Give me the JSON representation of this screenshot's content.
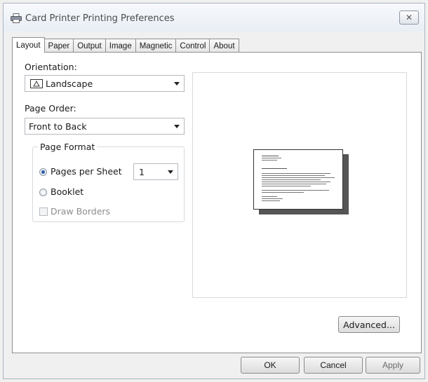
{
  "window": {
    "title": "Card Printer Printing Preferences",
    "close_glyph": "✕",
    "title_icon": "printer-icon"
  },
  "tabs": [
    {
      "label": "Layout",
      "active": true
    },
    {
      "label": "Paper"
    },
    {
      "label": "Output"
    },
    {
      "label": "Image"
    },
    {
      "label": "Magnetic"
    },
    {
      "label": "Control"
    },
    {
      "label": "About"
    }
  ],
  "layout": {
    "orientation_label": "Orientation:",
    "orientation_value": "Landscape",
    "orientation_icon": "landscape-icon",
    "page_order_label": "Page Order:",
    "page_order_value": "Front to Back",
    "page_format_label": "Page Format",
    "pages_per_sheet_label": "Pages per Sheet",
    "pages_per_sheet_value": "1",
    "booklet_label": "Booklet",
    "draw_borders_label": "Draw Borders",
    "selected_format": "pages-per-sheet",
    "draw_borders_checked": false,
    "advanced_label": "Advanced..."
  },
  "footer": {
    "ok_label": "OK",
    "cancel_label": "Cancel",
    "apply_label": "Apply"
  },
  "colors": {
    "accent": "#2c5fa8",
    "panel_border": "#8e8e8e"
  }
}
